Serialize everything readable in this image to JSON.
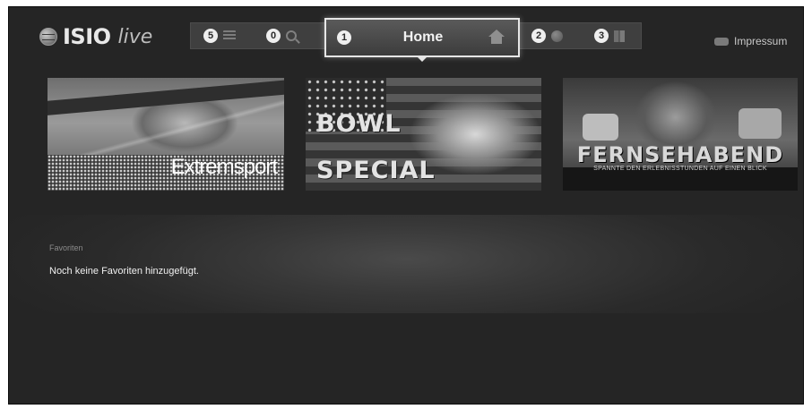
{
  "logo": {
    "brand": "ISIO",
    "suffix": "live",
    "icon": "globe-icon"
  },
  "nav": {
    "items": [
      {
        "number": "5",
        "icon": "list-icon"
      },
      {
        "number": "0",
        "icon": "search-icon"
      },
      {
        "number": "1",
        "label": "Home",
        "icon": "home-icon",
        "active": true
      },
      {
        "number": "2",
        "icon": "globe-icon"
      },
      {
        "number": "3",
        "icon": "book-icon"
      }
    ]
  },
  "impressum": {
    "label": "Impressum",
    "icon": "tag-icon"
  },
  "banners": [
    {
      "text": "Extremsport"
    },
    {
      "line1": "BOWL",
      "line2": "SPECIAL"
    },
    {
      "title": "FERNSEHABEND",
      "subtitle": "SPANNTE DEN ERLEBNISSTUNDEN AUF EINEN BLICK"
    }
  ],
  "favorites": {
    "title": "Favoriten",
    "empty_message": "Noch keine Favoriten hinzugefügt."
  },
  "colors": {
    "background": "#252525",
    "active_border": "#e6e6e6",
    "text": "#f0f0f0"
  }
}
